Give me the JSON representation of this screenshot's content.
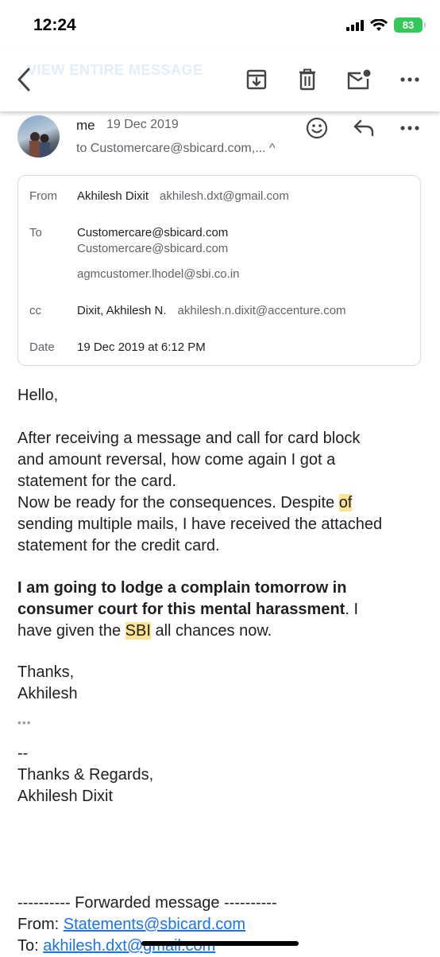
{
  "status_bar": {
    "time": "12:24",
    "battery": "83"
  },
  "toolbar": {
    "ghost_text": "VIEW ENTIRE MESSAGE"
  },
  "sender": {
    "name": "me",
    "date": "19 Dec 2019",
    "to_summary": "to Customercare@sbicard.com,... ^"
  },
  "details": {
    "from_label": "From",
    "from_name": "Akhilesh Dixit",
    "from_email": "akhilesh.dxt@gmail.com",
    "to_label": "To",
    "to_1": "Customercare@sbicard.com",
    "to_1_sub": "Customercare@sbicard.com",
    "to_2": "agmcustomer.lhodel@sbi.co.in",
    "cc_label": "cc",
    "cc_name": "Dixit, Akhilesh N.",
    "cc_email": "akhilesh.n.dixit@accenture.com",
    "date_label": "Date",
    "date_value": "19 Dec 2019 at 6:12 PM"
  },
  "body": {
    "greeting": "Hello,",
    "p1_l1": "After receiving a message and call for card block",
    "p1_l2": "and amount reversal, how come again I got a",
    "p1_l3": "statement for the card.",
    "p1_l4a": "Now be ready for the consequences. Despite ",
    "p1_l4_hl": "of",
    "p1_l5": "sending multiple mails, I have received the attached",
    "p1_l6": "statement for the credit card.",
    "p2_l1_bold": "I am going to lodge a complain tomorrow in",
    "p2_l2_bold": "consumer court for this mental harassment",
    "p2_l2_rest": ". I",
    "p2_l3a": "have given the ",
    "p2_l3_hl": "SBI",
    "p2_l3b": " all chances now.",
    "thanks": "Thanks,",
    "name": "Akhilesh",
    "ellipsis": "•••",
    "sig_sep": "--",
    "sig_regards": "Thanks & Regards,",
    "sig_name": "Akhilesh Dixit",
    "fwd_header": "---------- Forwarded message ----------",
    "fwd_from_label": "From: ",
    "fwd_from_email": "Statements@sbicard.com",
    "fwd_to_label": "To: ",
    "fwd_to_email": "akhilesh.dxt@gmail.com"
  },
  "colors": {
    "link": "#1a73e8",
    "highlight": "#fde293",
    "battery": "#34c759"
  }
}
